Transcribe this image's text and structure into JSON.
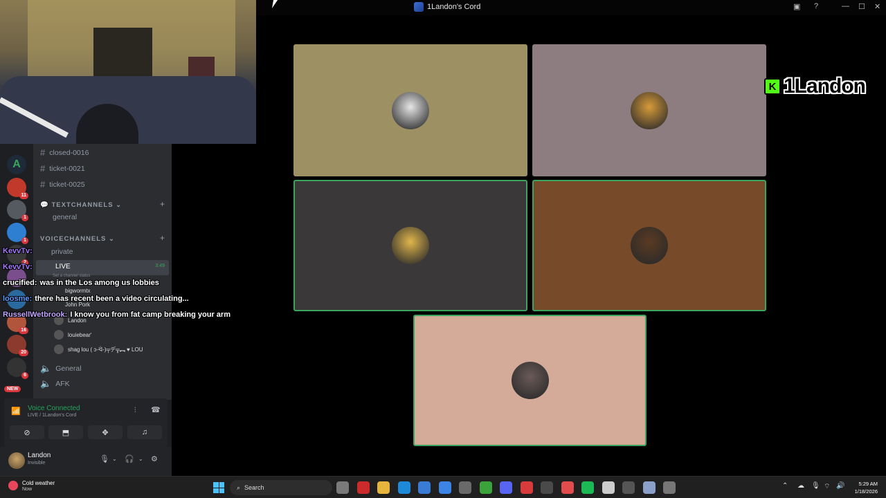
{
  "window": {
    "title": "1Landon's Cord"
  },
  "streamer": {
    "name": "1Landon",
    "platform_logo": "K"
  },
  "channels": {
    "text_top": [
      "closed-0016",
      "ticket-0021",
      "ticket-0025"
    ],
    "text_category": "TEXTCHANNELS",
    "text_list": [
      "general"
    ],
    "voice_category": "VOICECHANNELS",
    "voice_list": [
      {
        "name": "private"
      },
      {
        "name": "LIVE",
        "time": "3:49",
        "status_hint": "Set a channel status"
      }
    ],
    "voice_members": [
      "bigwormtx",
      "John Pork",
      "Landon",
      "louiebear'",
      "shag lou ( ɔ-ᐛ-)╤デ╦︻ ♥ LOU"
    ],
    "voice_bottom": [
      "General",
      "AFK"
    ]
  },
  "servers": [
    {
      "color": "#1f2a38",
      "letter": "A",
      "badge": ""
    },
    {
      "color": "#c0392b",
      "letter": "",
      "badge": "11"
    },
    {
      "color": "#555a60",
      "letter": "",
      "badge": "1"
    },
    {
      "color": "#2e7fd1",
      "letter": "",
      "badge": "1"
    },
    {
      "color": "#3a3a3a",
      "letter": "",
      "badge": "2"
    },
    {
      "color": "#7a4d8c",
      "letter": "",
      "badge": ""
    },
    {
      "color": "#2b6a9e",
      "letter": "",
      "badge": ""
    },
    {
      "color": "#b1563d",
      "letter": "",
      "badge": "16"
    },
    {
      "color": "#8c3a2d",
      "letter": "",
      "badge": "20"
    },
    {
      "color": "#333",
      "letter": "",
      "badge": "6"
    }
  ],
  "server_new_label": "NEW",
  "voice_panel": {
    "title": "Voice Connected",
    "subtitle": "LIVE / 1Landon's Cord",
    "buttons": [
      "camera-off-icon",
      "screen-share-icon",
      "activities-icon",
      "soundboard-icon"
    ]
  },
  "user_panel": {
    "name": "Landon",
    "status": "Invisible"
  },
  "chat_messages": [
    {
      "user": "KevvTv:",
      "user_color": "#a479ff",
      "text": ""
    },
    {
      "user": "KevvTv:",
      "user_color": "#a479ff",
      "text": ""
    },
    {
      "user": "crucified:",
      "user_color": "#ffffff",
      "text": "was in the Los among us lobbies"
    },
    {
      "user": "loosme:",
      "user_color": "#5a9cff",
      "text": "there has recent been a video circulating..."
    },
    {
      "user": "RussellWetbrook:",
      "user_color": "#c2a6ff",
      "text": "I know you from fat camp breaking your arm"
    }
  ],
  "video_tiles": [
    {
      "bg": "#9d9063",
      "avatar": "#e6e6e6",
      "speaking": false
    },
    {
      "bg": "#8d7c80",
      "avatar": "#d79b39",
      "speaking": false
    },
    {
      "bg": "#3a3838",
      "avatar": "#e0b64c",
      "speaking": true
    },
    {
      "bg": "#774a2a",
      "avatar": "#5b3a22",
      "speaking": true
    },
    {
      "bg": "#d4aa98",
      "avatar": "#6a5a58",
      "speaking": true
    }
  ],
  "taskbar": {
    "weather_title": "Cold weather",
    "weather_sub": "Now",
    "search_label": "Search",
    "time": "5:29 AM",
    "date": "1/18/2026",
    "apps": [
      "#7a7a7a",
      "#cc2b2b",
      "#e8b43c",
      "#1c8ad8",
      "#3a7bd5",
      "#3c84e6",
      "#6a6a6a",
      "#3aa33a",
      "#5865f2",
      "#d83b3b",
      "#4a4a4a",
      "#e34c4c",
      "#1db954",
      "#cccccc",
      "#555555",
      "#8aa0c8",
      "#777777"
    ]
  }
}
